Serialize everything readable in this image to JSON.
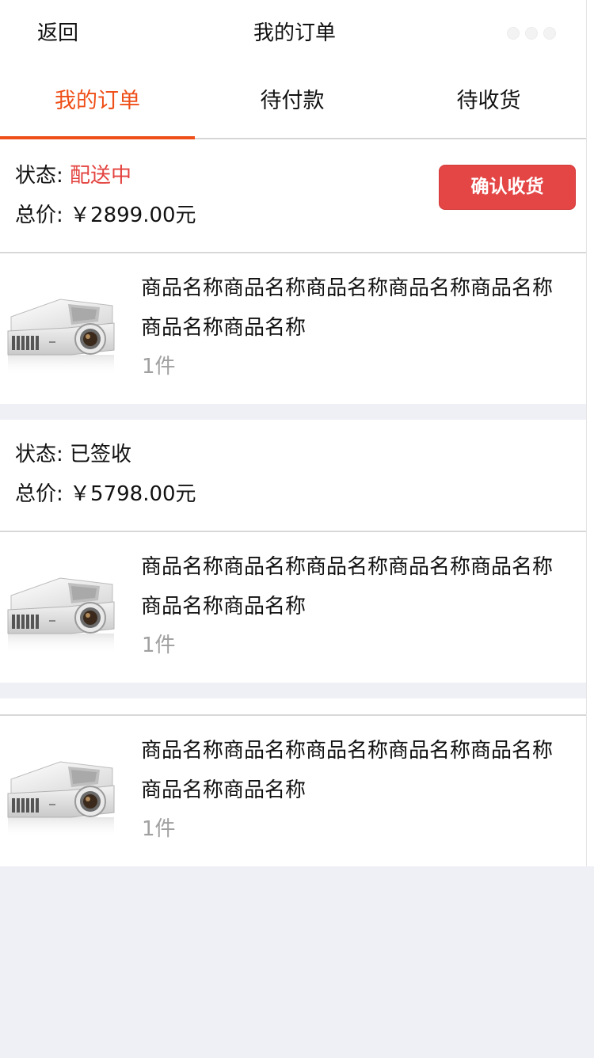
{
  "header": {
    "back_label": "返回",
    "title": "我的订单",
    "more_icon": "ellipsis-icon"
  },
  "tabs": [
    {
      "label": "我的订单",
      "active": true
    },
    {
      "label": "待付款",
      "active": false
    },
    {
      "label": "待收货",
      "active": false
    }
  ],
  "colors": {
    "accent": "#ef4f18",
    "status_red": "#e3433f",
    "button_red": "#e44646",
    "page_bg": "#efeff6",
    "muted_text": "#a0a0a0"
  },
  "orders": [
    {
      "status_label": "状态: ",
      "status_value": "配送中",
      "total_label": "总价: ",
      "total_value": "￥2899.00元",
      "action_label": "确认收货",
      "items": [
        {
          "name": "商品名称商品名称商品名称商品名称商品名称商品名称商品名称",
          "qty": "1件",
          "image_icon": "projector-image"
        }
      ]
    },
    {
      "status_label": "状态: ",
      "status_value": "已签收",
      "total_label": "总价: ",
      "total_value": "￥5798.00元",
      "items": [
        {
          "name": "商品名称商品名称商品名称商品名称商品名称商品名称商品名称",
          "qty": "1件",
          "image_icon": "projector-image"
        },
        {
          "name": "商品名称商品名称商品名称商品名称商品名称商品名称商品名称",
          "qty": "1件",
          "image_icon": "projector-image"
        }
      ]
    }
  ]
}
